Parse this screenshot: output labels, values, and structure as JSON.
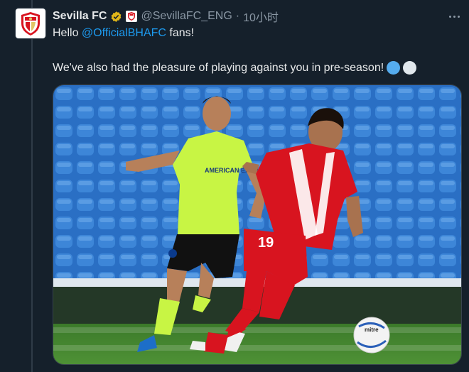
{
  "tweet": {
    "display_name": "Sevilla FC",
    "handle": "@SevillaFC_ENG",
    "separator": "·",
    "time": "10小时",
    "line1_prefix": "Hello ",
    "mention": "@OfficialBHAFC",
    "line1_suffix": " fans!",
    "line2": "We've also had the pleasure of playing against you in pre-season!",
    "emoji": [
      "blue-circle",
      "white-circle"
    ],
    "verified_badge": "gold-verified-icon",
    "affiliate_badge": "sevilla-crest-icon",
    "more_icon": "more-icon"
  },
  "media": {
    "left_jersey_text": "AMERICAN EXPRESS",
    "player_number": "19",
    "ball_brand": "mitre"
  },
  "colors": {
    "background": "#15202b",
    "text": "#e7e9ea",
    "secondary_text": "#8b98a5",
    "mention": "#1d9bf0",
    "verified_gold": "#e2b719",
    "sevilla_red": "#d8141f",
    "brighton_kit": "#c8f544",
    "emoji_blue": "#55acee",
    "emoji_white": "#e1e8ed"
  }
}
